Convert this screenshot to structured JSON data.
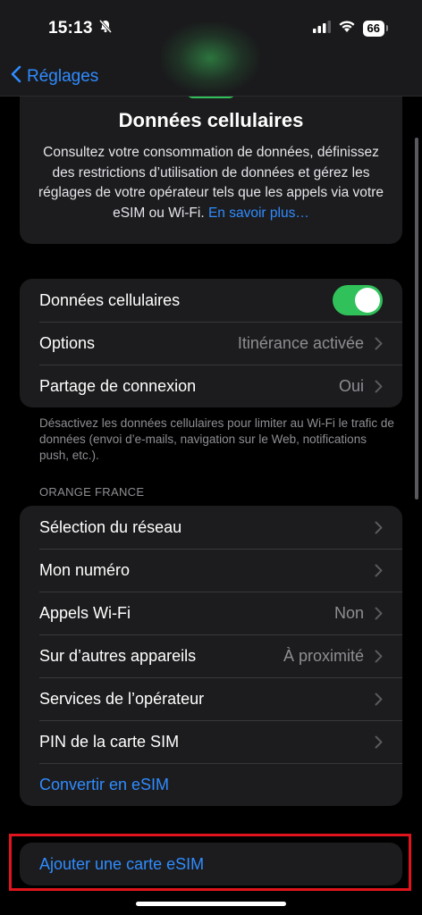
{
  "status_bar": {
    "time": "15:13",
    "battery": "66",
    "icons": [
      "bell-slash-icon",
      "cellular-signal-icon",
      "wifi-icon",
      "battery-icon"
    ]
  },
  "nav": {
    "back_label": "Réglages"
  },
  "info_card": {
    "title": "Données cellulaires",
    "description": "Consultez votre consommation de données, définissez des restrictions d’utilisation de données et gérez les réglages de votre opérateur tels que les appels via votre eSIM ou Wi-Fi.",
    "link": "En savoir plus…"
  },
  "group1": {
    "cellular_data": {
      "label": "Données cellulaires",
      "toggle_on": true
    },
    "options": {
      "label": "Options",
      "value": "Itinérance activée"
    },
    "hotspot": {
      "label": "Partage de connexion",
      "value": "Oui"
    }
  },
  "footnote": "Désactivez les données cellulaires pour limiter au Wi-Fi le trafic de données (envoi d’e-mails, navigation sur le Web, notifications push, etc.).",
  "carrier_section": {
    "header": "ORANGE FRANCE",
    "network_selection": {
      "label": "Sélection du réseau"
    },
    "my_number": {
      "label": "Mon numéro"
    },
    "wifi_calls": {
      "label": "Appels Wi-Fi",
      "value": "Non"
    },
    "other_devices": {
      "label": "Sur d’autres appareils",
      "value": "À proximité"
    },
    "carrier_services": {
      "label": "Services de l’opérateur"
    },
    "sim_pin": {
      "label": "PIN de la carte SIM"
    },
    "convert_esim": {
      "label": "Convertir en eSIM"
    }
  },
  "add_esim": {
    "label": "Ajouter une carte eSIM"
  },
  "colors": {
    "accent_blue": "#2f8cff",
    "toggle_green": "#30c15a",
    "highlight_red": "#e0141c"
  }
}
